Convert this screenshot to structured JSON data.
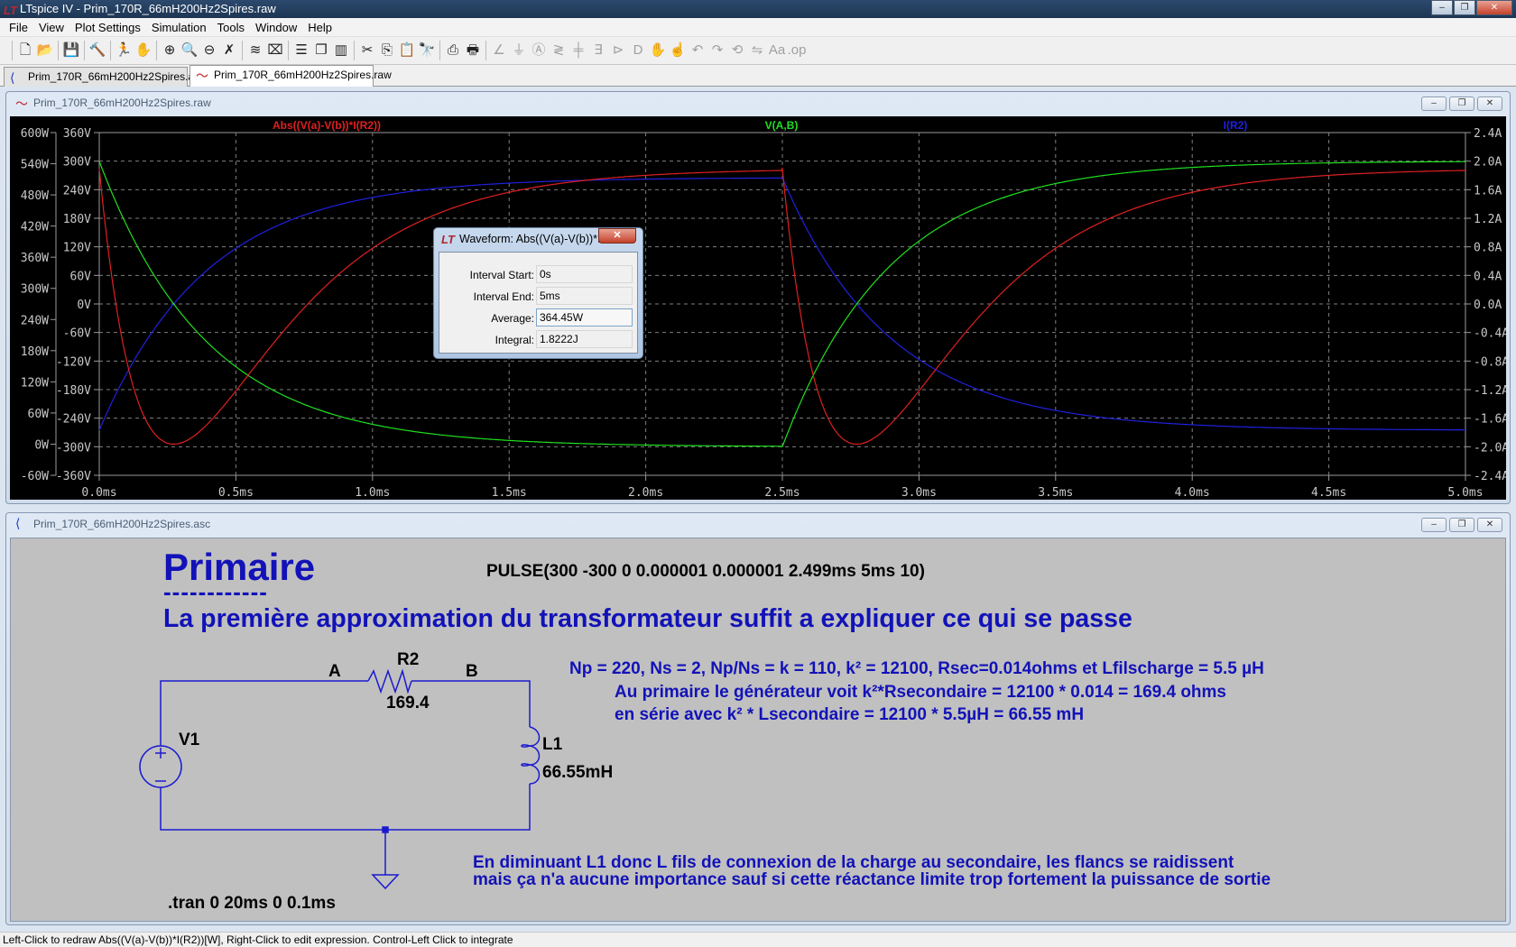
{
  "app": {
    "title": "LTspice IV - Prim_170R_66mH200Hz2Spires.raw",
    "logo": "LT"
  },
  "window_controls": {
    "minimize": "–",
    "restore": "❐",
    "close": "✕"
  },
  "menu": [
    "File",
    "View",
    "Plot Settings",
    "Simulation",
    "Tools",
    "Window",
    "Help"
  ],
  "toolbar": [
    [
      "new-schematic",
      "open-file"
    ],
    [
      "save"
    ],
    [
      "control-panel"
    ],
    [
      "run",
      "halt"
    ],
    [
      "zoom-in",
      "zoom-fit",
      "zoom-out",
      "zoom-cancel"
    ],
    [
      "autorange",
      "delete-trace"
    ],
    [
      "tile-horizontal",
      "cascade",
      "tile-vertical"
    ],
    [
      "cut",
      "copy",
      "paste",
      "find"
    ],
    [
      "print-preview",
      "print"
    ],
    [
      "draw-wire",
      "ground",
      "label-net",
      "resistor",
      "capacitor",
      "inductor",
      "diode",
      "component",
      "move",
      "drag",
      "undo",
      "redo",
      "rotate",
      "mirror",
      "text",
      "spice-directive"
    ]
  ],
  "tabs": [
    {
      "label": "Prim_170R_66mH200Hz2Spires.asc",
      "icon": "schematic-icon",
      "active": false
    },
    {
      "label": "Prim_170R_66mH200Hz2Spires.raw",
      "icon": "waveform-icon",
      "active": true
    }
  ],
  "plot_window": {
    "title": "Prim_170R_66mH200Hz2Spires.raw",
    "traces": [
      {
        "label": "Abs((V(a)-V(b))*I(R2))",
        "color": "#e02020"
      },
      {
        "label": "V(A,B)",
        "color": "#20e020"
      },
      {
        "label": "I(R2)",
        "color": "#2020e0"
      }
    ],
    "x_ticks": [
      "0.0ms",
      "0.5ms",
      "1.0ms",
      "1.5ms",
      "2.0ms",
      "2.5ms",
      "3.0ms",
      "3.5ms",
      "4.0ms",
      "4.5ms",
      "5.0ms"
    ],
    "x_range_ms": [
      0,
      5
    ],
    "y_left_power_ticks": [
      "600W",
      "540W",
      "480W",
      "420W",
      "360W",
      "300W",
      "240W",
      "180W",
      "120W",
      "60W",
      "0W",
      "-60W"
    ],
    "y_left_power_range_W": [
      -60,
      600
    ],
    "y_left_voltage_ticks": [
      "360V",
      "300V",
      "240V",
      "180V",
      "120V",
      "60V",
      "0V",
      "-60V",
      "-120V",
      "-180V",
      "-240V",
      "-300V",
      "-360V"
    ],
    "y_left_voltage_range_V": [
      -360,
      360
    ],
    "y_right_current_ticks": [
      "2.4A",
      "2.0A",
      "1.6A",
      "1.2A",
      "0.8A",
      "0.4A",
      "0.0A",
      "-0.4A",
      "-0.8A",
      "-1.2A",
      "-1.6A",
      "-2.0A",
      "-2.4A"
    ],
    "y_right_current_range_A": [
      -2.4,
      2.4
    ],
    "grid": true
  },
  "dialog": {
    "title": "Waveform: Abs((V(a)-V(b))*I...",
    "close": "✕",
    "rows": [
      {
        "label": "Interval Start:",
        "value": "0s"
      },
      {
        "label": "Interval End:",
        "value": "5ms"
      },
      {
        "label": "Average:",
        "value": "364.45W"
      },
      {
        "label": "Integral:",
        "value": "1.8222J"
      }
    ]
  },
  "schematic_window": {
    "title": "Prim_170R_66mH200Hz2Spires.asc",
    "heading": "Primaire",
    "heading_underline": "------------",
    "pulse": "PULSE(300 -300 0 0.000001 0.000001 2.499ms 5ms 10)",
    "subtitle": "La première approximation du transformateur suffit a expliquer ce qui se passe",
    "notes": [
      "Np = 220, Ns = 2, Np/Ns = k = 110,  k² = 12100, Rsec=0.014ohms et Lfilscharge = 5.5 µH",
      "Au primaire le générateur voit   k²*Rsecondaire = 12100 * 0.014 = 169.4 ohms",
      "en série avec k² * Lsecondaire = 12100 * 5.5µH = 66.55 mH"
    ],
    "comment": [
      "En diminuant L1 donc L fils de connexion de la charge au secondaire, les flancs se raidissent",
      "mais ça n'a aucune importance sauf si cette réactance limite trop fortement la puissance de sortie"
    ],
    "directive": ".tran 0 20ms 0 0.1ms",
    "components": {
      "source": {
        "name": "V1"
      },
      "resistor": {
        "name": "R2",
        "value": "169.4"
      },
      "inductor": {
        "name": "L1",
        "value": "66.55mH"
      },
      "nodes": [
        "A",
        "B"
      ]
    },
    "wire_color": "#1a1ad0"
  },
  "status": "Left-Click to redraw Abs((V(a)-V(b))*I(R2))[W],  Right-Click to edit expression. Control-Left Click to integrate"
}
